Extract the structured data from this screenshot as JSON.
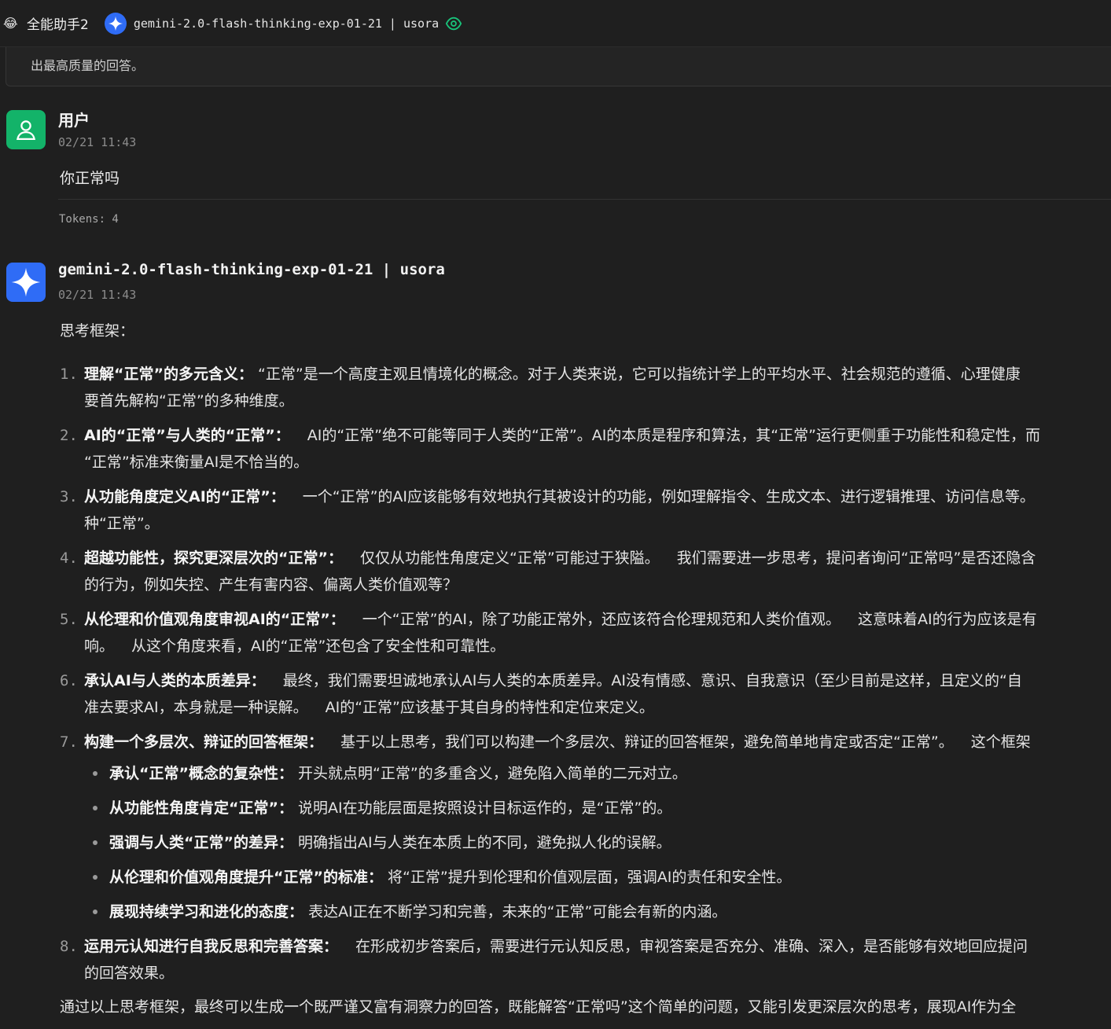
{
  "header": {
    "assistant_emoji": "😂",
    "assistant_name": "全能助手2",
    "model_name": "gemini-2.0-flash-thinking-exp-01-21 | usora"
  },
  "prompt_box": {
    "text": "出最高质量的回答。"
  },
  "user_message": {
    "sender": "用户",
    "time": "02/21 11:43",
    "text": "你正常吗",
    "tokens": "Tokens: 4"
  },
  "bot_message": {
    "sender": "gemini-2.0-flash-thinking-exp-01-21 | usora",
    "time": "02/21 11:43",
    "intro": "思考框架：",
    "steps": [
      {
        "num": "1.",
        "title": "理解“正常”的多元含义：",
        "line1": "“正常”是一个高度主观且情境化的概念。对于人类来说，它可以指统计学上的平均水平、社会规范的遵循、心理健康",
        "line2": "要首先解构“正常”的多种维度。"
      },
      {
        "num": "2.",
        "title": "AI的“正常”与人类的“正常”：",
        "line1": "AI的“正常”绝不可能等同于人类的“正常”。AI的本质是程序和算法，其“正常”运行更侧重于功能性和稳定性，而",
        "line2": "“正常”标准来衡量AI是不恰当的。"
      },
      {
        "num": "3.",
        "title": "从功能角度定义AI的“正常”：",
        "line1": "一个“正常”的AI应该能够有效地执行其被设计的功能，例如理解指令、生成文本、进行逻辑推理、访问信息等。",
        "line2": "种“正常”。"
      },
      {
        "num": "4.",
        "title": "超越功能性，探究更深层次的“正常”：",
        "line1": "仅仅从功能性角度定义“正常”可能过于狭隘。",
        "line1b": "我们需要进一步思考，提问者询问“正常吗”是否还隐含",
        "line2": "的行为，例如失控、产生有害内容、偏离人类价值观等？"
      },
      {
        "num": "5.",
        "title": "从伦理和价值观角度审视AI的“正常”：",
        "line1": "一个“正常”的AI，除了功能正常外，还应该符合伦理规范和人类价值观。",
        "line1b": "这意味着AI的行为应该是有",
        "line2": "响。",
        "line2b": "从这个角度来看，AI的“正常”还包含了安全性和可靠性。"
      },
      {
        "num": "6.",
        "title": "承认AI与人类的本质差异：",
        "line1": "最终，我们需要坦诚地承认AI与人类的本质差异。AI没有情感、意识、自我意识（至少目前是这样，且定义的“自",
        "line2": "准去要求AI，本身就是一种误解。",
        "line2b": "AI的“正常”应该基于其自身的特性和定位来定义。"
      },
      {
        "num": "7.",
        "title": "构建一个多层次、辩证的回答框架：",
        "line1": "基于以上思考，我们可以构建一个多层次、辩证的回答框架，避免简单地肯定或否定“正常”。",
        "line1b": "这个框架"
      },
      {
        "num": "8.",
        "title": "运用元认知进行自我反思和完善答案：",
        "line1": "在形成初步答案后，需要进行元认知反思，审视答案是否充分、准确、深入，是否能够有效地回应提问",
        "line2": "的回答效果。"
      }
    ],
    "sub_points": [
      {
        "title": "承认“正常”概念的复杂性：",
        "text": "开头就点明“正常”的多重含义，避免陷入简单的二元对立。"
      },
      {
        "title": "从功能性角度肯定“正常”：",
        "text": "说明AI在功能层面是按照设计目标运作的，是“正常”的。"
      },
      {
        "title": "强调与人类“正常”的差异：",
        "text": "明确指出AI与人类在本质上的不同，避免拟人化的误解。"
      },
      {
        "title": "从伦理和价值观角度提升“正常”的标准：",
        "text": "将“正常”提升到伦理和价值观层面，强调AI的责任和安全性。"
      },
      {
        "title": "展现持续学习和进化的态度：",
        "text": "表达AI正在不断学习和完善，未来的“正常”可能会有新的内涵。"
      }
    ],
    "summary": "通过以上思考框架，最终可以生成一个既严谨又富有洞察力的回答，既能解答“正常吗”这个简单的问题，又能引发更深层次的思考，展现AI作为全"
  }
}
